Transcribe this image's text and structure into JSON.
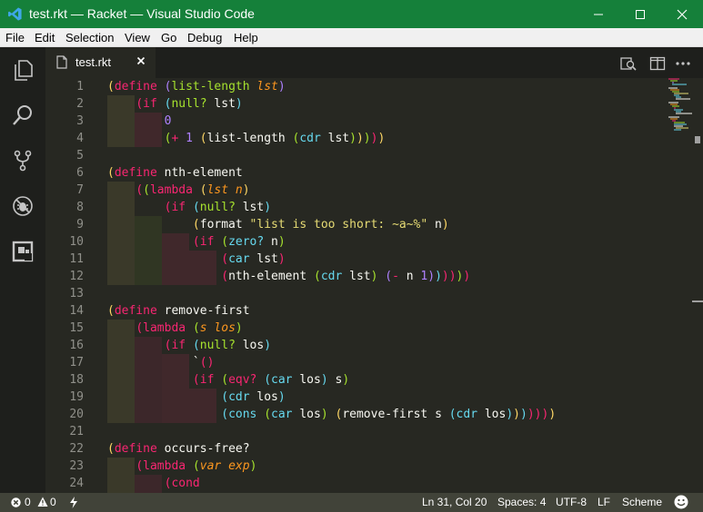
{
  "window": {
    "title": "test.rkt — Racket — Visual Studio Code",
    "controls": [
      "minimize",
      "maximize",
      "close"
    ]
  },
  "menu": [
    "File",
    "Edit",
    "Selection",
    "View",
    "Go",
    "Debug",
    "Help"
  ],
  "activity_bar": [
    "explorer-icon",
    "search-icon",
    "source-control-icon",
    "debug-icon",
    "extensions-icon"
  ],
  "tab": {
    "title": "test.rkt"
  },
  "editor": {
    "lines": [
      {
        "n": "1",
        "t": [
          [
            "(",
            "#ffd866"
          ],
          [
            "define ",
            "#f92672"
          ],
          [
            "(",
            "#ae81ff"
          ],
          [
            "list-length ",
            "#a6e22e"
          ],
          [
            "lst",
            "#fd971f",
            "i"
          ],
          [
            ")",
            "#ae81ff"
          ]
        ]
      },
      {
        "n": "2",
        "t": [
          [
            "    ",
            ""
          ],
          [
            "(",
            "#f92672"
          ],
          [
            "if ",
            "#f92672"
          ],
          [
            "(",
            "#66d9ef"
          ],
          [
            "null? ",
            "#a6e22e"
          ],
          [
            "lst",
            "#f8f8f2"
          ],
          [
            ")",
            "#66d9ef"
          ]
        ]
      },
      {
        "n": "3",
        "t": [
          [
            "        ",
            ""
          ],
          [
            "0",
            "#ae81ff"
          ]
        ]
      },
      {
        "n": "4",
        "t": [
          [
            "        ",
            ""
          ],
          [
            "(",
            "#a6e22e"
          ],
          [
            "+ ",
            "#f92672"
          ],
          [
            "1 ",
            "#ae81ff"
          ],
          [
            "(",
            "#ffd866"
          ],
          [
            "list-length ",
            "#f8f8f2"
          ],
          [
            "(",
            "#a6e22e"
          ],
          [
            "cdr ",
            "#66d9ef"
          ],
          [
            "lst",
            "#f8f8f2"
          ],
          [
            ")",
            "#a6e22e"
          ],
          [
            ")",
            "#ffd866"
          ],
          [
            ")",
            "#a6e22e"
          ],
          [
            ")",
            "#f92672"
          ],
          [
            ")",
            "#ffd866"
          ]
        ]
      },
      {
        "n": "5",
        "t": []
      },
      {
        "n": "6",
        "t": [
          [
            "(",
            "#ffd866"
          ],
          [
            "define ",
            "#f92672"
          ],
          [
            "nth-element",
            "#f8f8f2"
          ]
        ]
      },
      {
        "n": "7",
        "t": [
          [
            "    ",
            ""
          ],
          [
            "(",
            "#f92672"
          ],
          [
            "(",
            "#a6e22e"
          ],
          [
            "lambda ",
            "#f92672"
          ],
          [
            "(",
            "#ffd866"
          ],
          [
            "lst n",
            "#fd971f",
            "i"
          ],
          [
            ")",
            "#ffd866"
          ]
        ]
      },
      {
        "n": "8",
        "t": [
          [
            "        ",
            ""
          ],
          [
            "(",
            "#f92672"
          ],
          [
            "if ",
            "#f92672"
          ],
          [
            "(",
            "#66d9ef"
          ],
          [
            "null? ",
            "#a6e22e"
          ],
          [
            "lst",
            "#f8f8f2"
          ],
          [
            ")",
            "#66d9ef"
          ]
        ]
      },
      {
        "n": "9",
        "t": [
          [
            "            ",
            ""
          ],
          [
            "(",
            "#ffd866"
          ],
          [
            "format ",
            "#f8f8f2"
          ],
          [
            "\"list is too short: ~a~%\"",
            "#e6db74"
          ],
          [
            " n",
            "#f8f8f2"
          ],
          [
            ")",
            "#ffd866"
          ]
        ]
      },
      {
        "n": "10",
        "t": [
          [
            "            ",
            ""
          ],
          [
            "(",
            "#f92672"
          ],
          [
            "if ",
            "#f92672"
          ],
          [
            "(",
            "#a6e22e"
          ],
          [
            "zero? ",
            "#66d9ef"
          ],
          [
            "n",
            "#f8f8f2"
          ],
          [
            ")",
            "#a6e22e"
          ]
        ]
      },
      {
        "n": "11",
        "t": [
          [
            "                ",
            ""
          ],
          [
            "(",
            "#f92672"
          ],
          [
            "car ",
            "#66d9ef"
          ],
          [
            "lst",
            "#f8f8f2"
          ],
          [
            ")",
            "#f92672"
          ]
        ]
      },
      {
        "n": "12",
        "t": [
          [
            "                ",
            ""
          ],
          [
            "(",
            "#f92672"
          ],
          [
            "nth-element ",
            "#f8f8f2"
          ],
          [
            "(",
            "#a6e22e"
          ],
          [
            "cdr ",
            "#66d9ef"
          ],
          [
            "lst",
            "#f8f8f2"
          ],
          [
            ")",
            "#a6e22e"
          ],
          [
            " ",
            ""
          ],
          [
            "(",
            "#ae81ff"
          ],
          [
            "- ",
            "#f92672"
          ],
          [
            "n ",
            "#f8f8f2"
          ],
          [
            "1",
            "#ae81ff"
          ],
          [
            ")",
            "#ae81ff"
          ],
          [
            ")",
            "#66d9ef"
          ],
          [
            ")",
            "#f92672"
          ],
          [
            ")",
            "#f92672"
          ],
          [
            ")",
            "#a6e22e"
          ],
          [
            ")",
            "#f92672"
          ]
        ]
      },
      {
        "n": "13",
        "t": []
      },
      {
        "n": "14",
        "t": [
          [
            "(",
            "#ffd866"
          ],
          [
            "define ",
            "#f92672"
          ],
          [
            "remove-first",
            "#f8f8f2"
          ]
        ]
      },
      {
        "n": "15",
        "t": [
          [
            "    ",
            ""
          ],
          [
            "(",
            "#f92672"
          ],
          [
            "lambda ",
            "#f92672"
          ],
          [
            "(",
            "#a6e22e"
          ],
          [
            "s los",
            "#fd971f",
            "i"
          ],
          [
            ")",
            "#a6e22e"
          ]
        ]
      },
      {
        "n": "16",
        "t": [
          [
            "        ",
            ""
          ],
          [
            "(",
            "#f92672"
          ],
          [
            "if ",
            "#f92672"
          ],
          [
            "(",
            "#66d9ef"
          ],
          [
            "null? ",
            "#a6e22e"
          ],
          [
            "los",
            "#f8f8f2"
          ],
          [
            ")",
            "#66d9ef"
          ]
        ]
      },
      {
        "n": "17",
        "t": [
          [
            "            ",
            ""
          ],
          [
            "`",
            "#f8f8f2"
          ],
          [
            "()",
            "#f92672"
          ]
        ]
      },
      {
        "n": "18",
        "t": [
          [
            "            ",
            ""
          ],
          [
            "(",
            "#f92672"
          ],
          [
            "if ",
            "#f92672"
          ],
          [
            "(",
            "#a6e22e"
          ],
          [
            "eqv? ",
            "#f92672"
          ],
          [
            "(",
            "#66d9ef"
          ],
          [
            "car ",
            "#66d9ef"
          ],
          [
            "los",
            "#f8f8f2"
          ],
          [
            ")",
            "#66d9ef"
          ],
          [
            " s",
            "#f8f8f2"
          ],
          [
            ")",
            "#a6e22e"
          ]
        ]
      },
      {
        "n": "19",
        "t": [
          [
            "                ",
            ""
          ],
          [
            "(",
            "#66d9ef"
          ],
          [
            "cdr ",
            "#66d9ef"
          ],
          [
            "los",
            "#f8f8f2"
          ],
          [
            ")",
            "#66d9ef"
          ]
        ]
      },
      {
        "n": "20",
        "t": [
          [
            "                ",
            ""
          ],
          [
            "(",
            "#66d9ef"
          ],
          [
            "cons ",
            "#66d9ef"
          ],
          [
            "(",
            "#a6e22e"
          ],
          [
            "car ",
            "#66d9ef"
          ],
          [
            "los",
            "#f8f8f2"
          ],
          [
            ")",
            "#a6e22e"
          ],
          [
            " ",
            ""
          ],
          [
            "(",
            "#ffd866"
          ],
          [
            "remove-first ",
            "#f8f8f2"
          ],
          [
            "s ",
            "#f8f8f2"
          ],
          [
            "(",
            "#66d9ef"
          ],
          [
            "cdr ",
            "#66d9ef"
          ],
          [
            "los",
            "#f8f8f2"
          ],
          [
            ")",
            "#66d9ef"
          ],
          [
            ")",
            "#ffd866"
          ],
          [
            ")",
            "#66d9ef"
          ],
          [
            ")",
            "#f92672"
          ],
          [
            ")",
            "#f92672"
          ],
          [
            ")",
            "#f92672"
          ],
          [
            ")",
            "#ffd866"
          ]
        ]
      },
      {
        "n": "21",
        "t": []
      },
      {
        "n": "22",
        "t": [
          [
            "(",
            "#ffd866"
          ],
          [
            "define ",
            "#f92672"
          ],
          [
            "occurs-free?",
            "#f8f8f2"
          ]
        ]
      },
      {
        "n": "23",
        "t": [
          [
            "    ",
            ""
          ],
          [
            "(",
            "#f92672"
          ],
          [
            "lambda ",
            "#f92672"
          ],
          [
            "(",
            "#a6e22e"
          ],
          [
            "var exp",
            "#fd971f",
            "i"
          ],
          [
            ")",
            "#a6e22e"
          ]
        ]
      },
      {
        "n": "24",
        "t": [
          [
            "        ",
            ""
          ],
          [
            "(",
            "#f92672"
          ],
          [
            "cond",
            "#f92672"
          ]
        ]
      }
    ]
  },
  "status": {
    "errors": "0",
    "warnings": "0",
    "position": "Ln 31, Col 20",
    "spaces": "Spaces: 4",
    "encoding": "UTF-8",
    "eol": "LF",
    "language": "Scheme"
  },
  "colors": {
    "titlebar": "#15803a",
    "editor_bg": "#272822",
    "statusbar": "#414339"
  }
}
